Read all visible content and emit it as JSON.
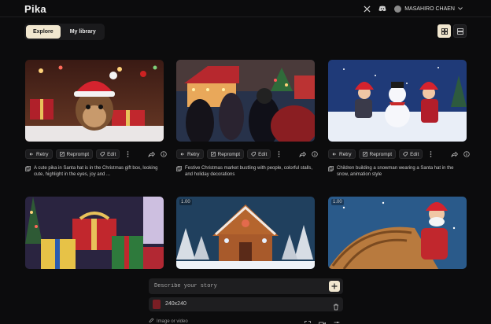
{
  "header": {
    "logo": "Pika",
    "user_name": "MASAHIRO CHAEN"
  },
  "tabs": [
    {
      "label": "Explore",
      "active": true
    },
    {
      "label": "My library",
      "active": false
    }
  ],
  "card_actions": {
    "retry": "Retry",
    "reprompt": "Reprompt",
    "edit": "Edit"
  },
  "cards": [
    {
      "duration": "",
      "caption": "A cute pika in Santa hat is in the Christmas gift box, looking cute, highlight in the eyes, joy and ..."
    },
    {
      "duration": "",
      "caption": "Festive Christmas market bustling with people, colorful stalls, and holiday decorations"
    },
    {
      "duration": "",
      "caption": "Children building a snowman wearing a Santa hat in the snow, animation style"
    },
    {
      "duration": "",
      "caption": ""
    },
    {
      "duration": "1.00",
      "caption": ""
    },
    {
      "duration": "1.00",
      "caption": ""
    }
  ],
  "composer": {
    "placeholder": "Describe your story",
    "resolution": "240x240",
    "image_or_video": "Image or video"
  },
  "colors": {
    "accent": "#f1e7cf",
    "background": "#0c0c0d",
    "panel": "#1e1e20"
  }
}
